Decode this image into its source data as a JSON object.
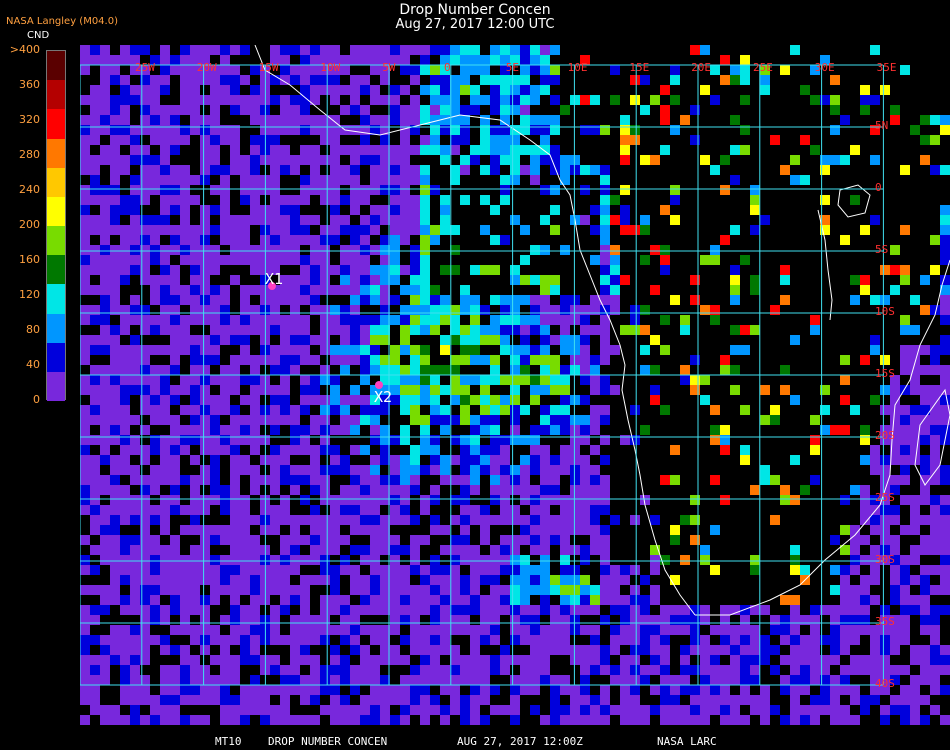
{
  "header": {
    "title": "Drop Number Concen",
    "datetime": "Aug 27, 2017 12:00 UTC"
  },
  "org_label": "NASA Langley (M04.0)",
  "colorbar": {
    "unit": "CND",
    "labels": [
      ">400",
      "360",
      "320",
      "280",
      "240",
      "200",
      "160",
      "120",
      "80",
      "40",
      "0"
    ],
    "colors": [
      "#5a0000",
      "#b40000",
      "#ff0000",
      "#ff7800",
      "#ffc800",
      "#ffff00",
      "#78dc00",
      "#007800",
      "#00e6e6",
      "#0096ff",
      "#0000dc",
      "#7828dc"
    ]
  },
  "map": {
    "lon_labels": [
      "25W",
      "20W",
      "15W",
      "10W",
      "5W",
      "0",
      "5E",
      "10E",
      "15E",
      "20E",
      "25E",
      "30E",
      "35E"
    ],
    "lat_labels": [
      "5N",
      "0",
      "5S",
      "10S",
      "15S",
      "20S",
      "25S",
      "30S",
      "35S",
      "40S"
    ],
    "markers": [
      {
        "label": "X1",
        "color": "#ff40c0"
      },
      {
        "label": "X2",
        "color": "#ff40c0"
      }
    ]
  },
  "footer": {
    "product": "MT10",
    "name": "DROP NUMBER CONCEN",
    "datetime": "AUG 27, 2017 12:00Z",
    "source": "NASA LARC"
  },
  "colors": {
    "grid": "#40e0f0",
    "coast": "#ffffff",
    "label_red": "#ff3030",
    "text_orange": "#ffa040"
  }
}
